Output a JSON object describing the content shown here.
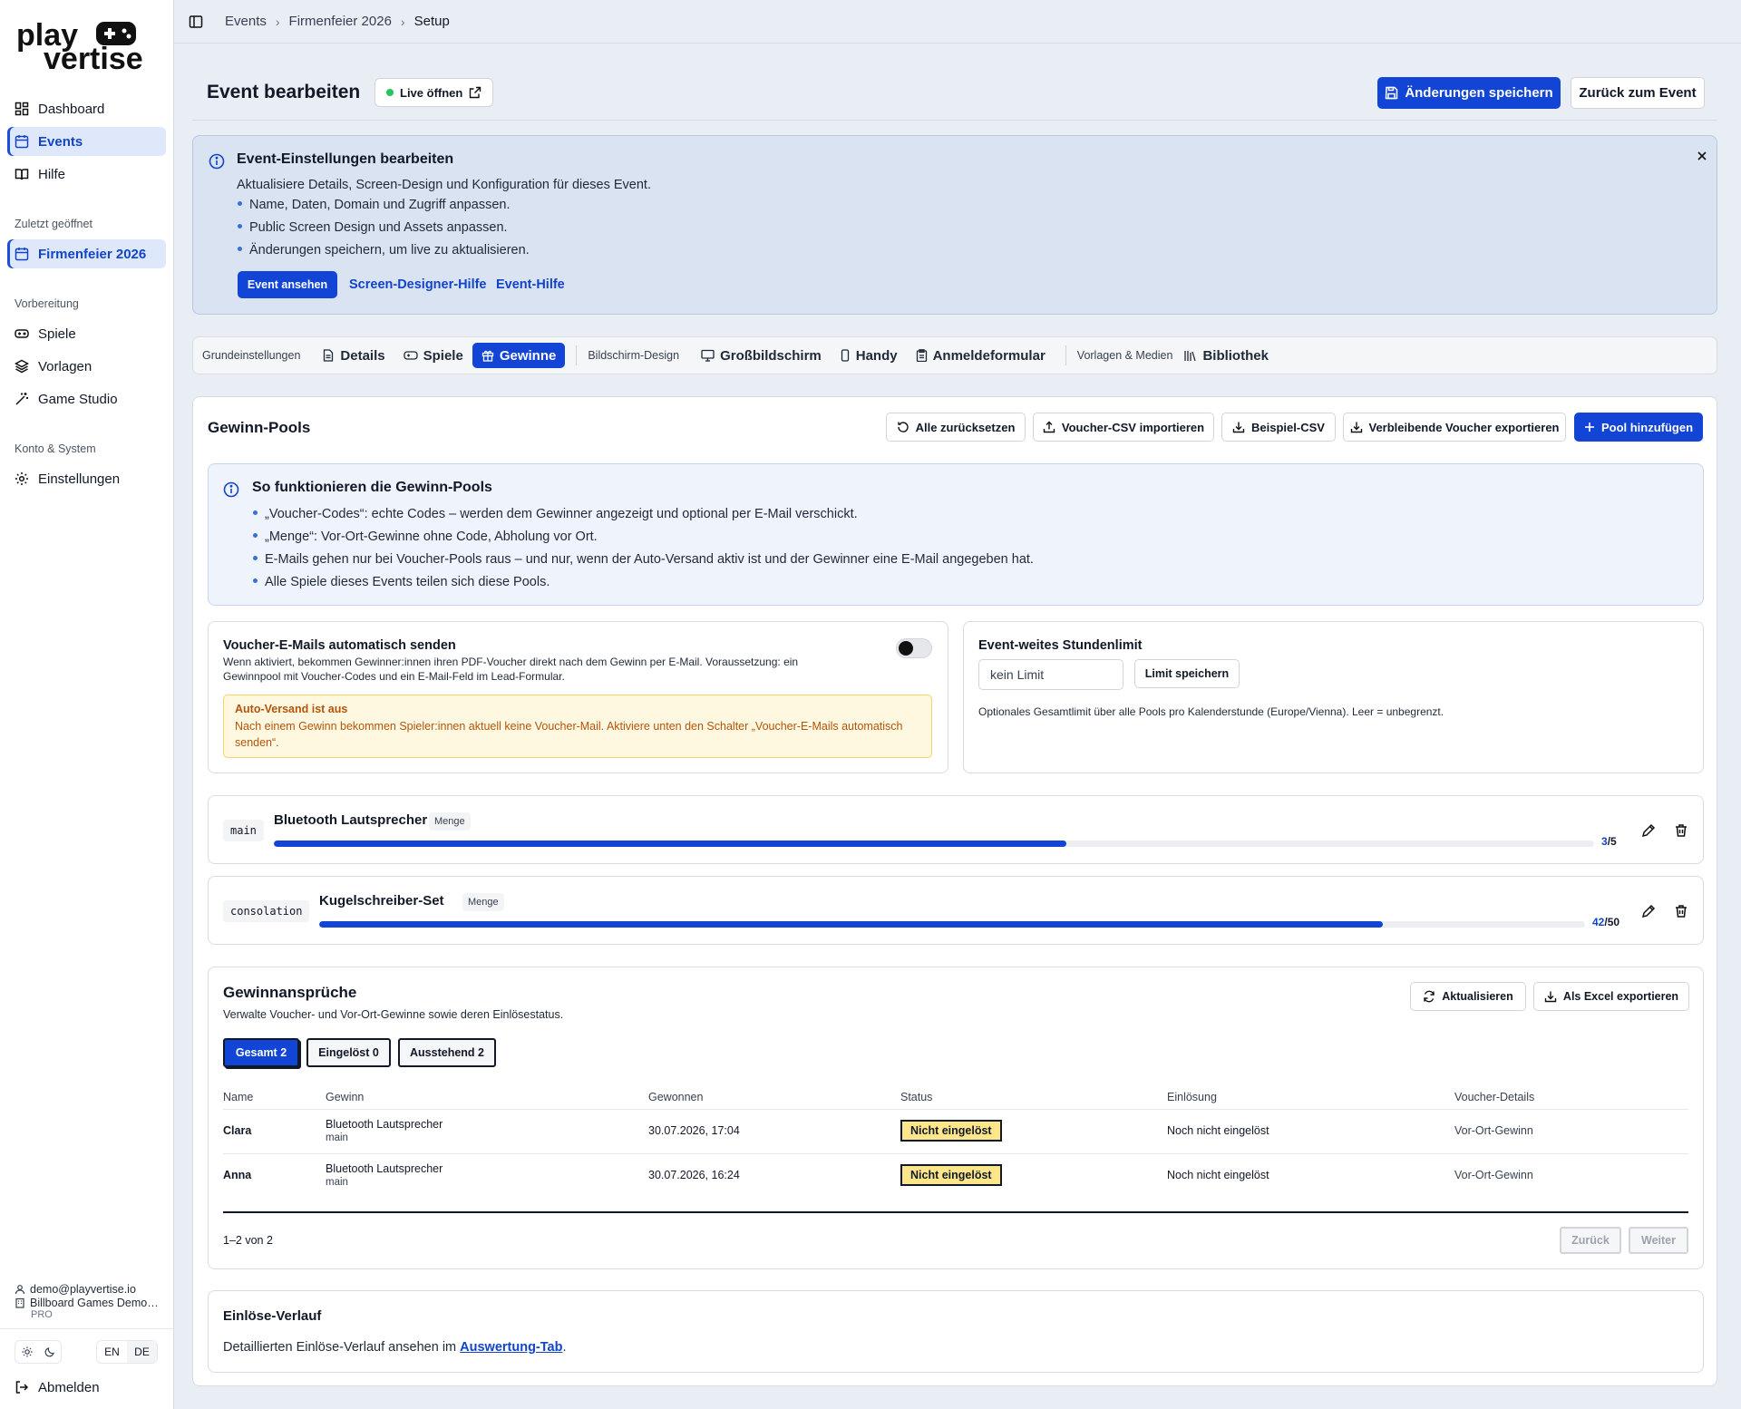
{
  "brand": {
    "logo_text_1": "play",
    "logo_text_2": "vertise",
    "accent": "#1244d6"
  },
  "sidebar": {
    "nav": [
      {
        "label": "Dashboard",
        "icon": "dashboard-icon"
      },
      {
        "label": "Events",
        "icon": "calendar-icon"
      },
      {
        "label": "Hilfe",
        "icon": "book-icon"
      }
    ],
    "recent_title": "Zuletzt geöffnet",
    "recent_item": "Firmenfeier 2026",
    "prep_title": "Vorbereitung",
    "prep_items": [
      {
        "label": "Spiele",
        "icon": "gamepad-icon"
      },
      {
        "label": "Vorlagen",
        "icon": "layers-icon"
      },
      {
        "label": "Game Studio",
        "icon": "wand-icon"
      }
    ],
    "account_title": "Konto & System",
    "settings_label": "Einstellungen",
    "user_email": "demo@playvertise.io",
    "org_name": "Billboard Games Demo…",
    "plan": "PRO",
    "lang_en": "EN",
    "lang_de": "DE",
    "logout_label": "Abmelden"
  },
  "breadcrumb": [
    "Events",
    "Firmenfeier 2026",
    "Setup"
  ],
  "header": {
    "title": "Event bearbeiten",
    "live_label": "Live öffnen",
    "save_label": "Änderungen speichern",
    "back_label": "Zurück zum Event"
  },
  "banner": {
    "title": "Event-Einstellungen bearbeiten",
    "desc": "Aktualisiere Details, Screen-Design und Konfiguration für dieses Event.",
    "bullets": [
      "Name, Daten, Domain und Zugriff anpassen.",
      "Public Screen Design und Assets anpassen.",
      "Änderungen speichern, um live zu aktualisieren."
    ],
    "view_event": "Event ansehen",
    "link_designer": "Screen-Designer-Hilfe",
    "link_event": "Event-Hilfe"
  },
  "tabs": {
    "group1": "Grundeinstellungen",
    "details": "Details",
    "spiele": "Spiele",
    "gewinne": "Gewinne",
    "group2": "Bildschirm-Design",
    "grossbild": "Großbildschirm",
    "handy": "Handy",
    "anmelde": "Anmeldeformular",
    "group3": "Vorlagen & Medien",
    "bibliothek": "Bibliothek"
  },
  "pools": {
    "title": "Gewinn-Pools",
    "toolbar": {
      "reset": "Alle zurücksetzen",
      "import_csv": "Voucher-CSV importieren",
      "sample_csv": "Beispiel-CSV",
      "export_remaining": "Verbleibende Voucher exportieren",
      "add_pool": "Pool hinzufügen"
    },
    "howto_title": "So funktionieren die Gewinn-Pools",
    "howto_bullets": [
      "„Voucher-Codes“: echte Codes – werden dem Gewinner angezeigt und optional per E-Mail verschickt.",
      "„Menge“: Vor-Ort-Gewinne ohne Code, Abholung vor Ort.",
      "E-Mails gehen nur bei Voucher-Pools raus – und nur, wenn der Auto-Versand aktiv ist und der Gewinner eine E-Mail angegeben hat.",
      "Alle Spiele dieses Events teilen sich diese Pools."
    ],
    "auto_mail_title": "Voucher-E-Mails automatisch senden",
    "auto_mail_desc": "Wenn aktiviert, bekommen Gewinner:innen ihren PDF-Voucher direkt nach dem Gewinn per E-Mail. Voraussetzung: ein Gewinnpool mit Voucher-Codes und ein E-Mail-Feld im Lead-Formular.",
    "auto_mail_enabled": false,
    "warn_title": "Auto-Versand ist aus",
    "warn_text": "Nach einem Gewinn bekommen Spieler:innen aktuell keine Voucher-Mail. Aktiviere unten den Schalter „Voucher-E-Mails automatisch senden“.",
    "limit_title": "Event-weites Stundenlimit",
    "limit_value": "kein Limit",
    "limit_save": "Limit speichern",
    "limit_desc": "Optionales Gesamtlimit über alle Pools pro Kalenderstunde (Europe/Vienna). Leer = unbegrenzt.",
    "items": [
      {
        "key": "main",
        "name": "Bluetooth Lautsprecher",
        "type": "Menge",
        "used": "3",
        "total": "/5",
        "fraction": 0.6
      },
      {
        "key": "consolation",
        "name": "Kugelschreiber-Set",
        "type": "Menge",
        "used": "42",
        "total": "/50",
        "fraction": 0.84
      }
    ]
  },
  "claims": {
    "title": "Gewinnansprüche",
    "desc": "Verwalte Voucher- und Vor-Ort-Gewinne sowie deren Einlösestatus.",
    "refresh": "Aktualisieren",
    "export_excel": "Als Excel exportieren",
    "filters": [
      "Gesamt 2",
      "Eingelöst 0",
      "Ausstehend 2"
    ],
    "columns": [
      "Name",
      "Gewinn",
      "Gewonnen",
      "Status",
      "Einlösung",
      "Voucher-Details"
    ],
    "rows": [
      {
        "name": "Clara",
        "prize": "Bluetooth Lautsprecher",
        "pool": "main",
        "won": "30.07.2026, 17:04",
        "status": "Nicht eingelöst",
        "redeem": "Noch nicht eingelöst",
        "details": "Vor-Ort-Gewinn"
      },
      {
        "name": "Anna",
        "prize": "Bluetooth Lautsprecher",
        "pool": "main",
        "won": "30.07.2026, 16:24",
        "status": "Nicht eingelöst",
        "redeem": "Noch nicht eingelöst",
        "details": "Vor-Ort-Gewinn"
      }
    ],
    "range": "1–2 von 2",
    "prev": "Zurück",
    "next": "Weiter"
  },
  "history": {
    "title": "Einlöse-Verlauf",
    "text": "Detaillierten Einlöse-Verlauf ansehen im",
    "link": "Auswertung-Tab",
    "period": "."
  }
}
